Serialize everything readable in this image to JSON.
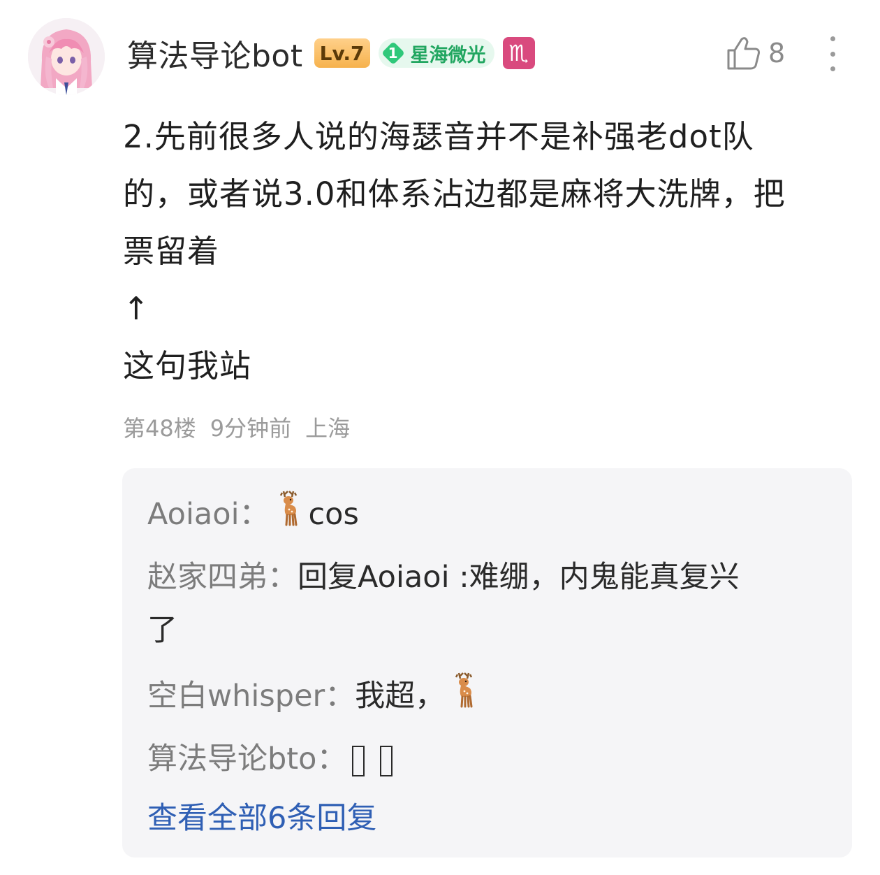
{
  "comment": {
    "username": "算法导论bot",
    "level_badge": "Lv.7",
    "fan_badge_number": "1",
    "fan_badge_text": "星海微光",
    "zodiac_symbol": "♏",
    "like_count": "8",
    "lines": [
      "2.先前很多人说的海瑟音并不是补强老dot队",
      "的，或者说3.0和体系沾边都是麻将大洗牌，把",
      "票留着",
      "↑",
      "这句我站"
    ],
    "floor": "第48楼",
    "time": "9分钟前",
    "location": "上海"
  },
  "replies": [
    {
      "name": "Aoiaoi：",
      "text_after_emoji": "cos",
      "emoji": "deer"
    },
    {
      "name": "赵家四弟：",
      "text": "回复Aoiaoi :难绷，内鬼能真复兴",
      "text_line2": "了"
    },
    {
      "name": "空白whisper：",
      "text": "我超，",
      "emoji": "deer"
    },
    {
      "name": "算法导论bto：",
      "glyphs": "missing-glyph-boxes"
    }
  ],
  "view_all_label": "查看全部6条回复",
  "colors": {
    "link": "#2f5fb4",
    "meta": "#9b9b9b",
    "reply_bg": "#f5f5f7",
    "level_badge": "#f6b24d",
    "fan_badge": "#2fc87a",
    "zodiac_badge": "#d94a7e"
  }
}
